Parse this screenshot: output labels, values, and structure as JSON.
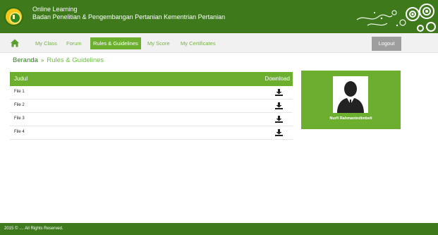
{
  "header": {
    "title": "Online Learning",
    "subtitle": "Badan Penelitian & Pengembangan Pertanian Kementrian Pertanian"
  },
  "nav": {
    "home_icon": "home-icon",
    "items": [
      "My Class",
      "Forum",
      "Rules & Guidelines",
      "My Score",
      "My Certificates"
    ],
    "active": "Rules & Guidelines",
    "logout": "Logout"
  },
  "breadcrumb": {
    "home": "Beranda",
    "separator": "»",
    "current": "Rules & Guidelines"
  },
  "table": {
    "headers": {
      "judul": "Judul",
      "download": "Download"
    },
    "rows": [
      "File 1",
      "File 2",
      "File 3",
      "File 4"
    ]
  },
  "profile": {
    "name": "Nurfi Rahmanindimbeli"
  },
  "footer": {
    "text": "2015 © .... All Rights Reserved."
  },
  "colors": {
    "header_green": "#3e7a1c",
    "accent_green": "#6caf2f",
    "nav_bg": "#f1f1f1",
    "logout_gray": "#9e9e9e"
  }
}
